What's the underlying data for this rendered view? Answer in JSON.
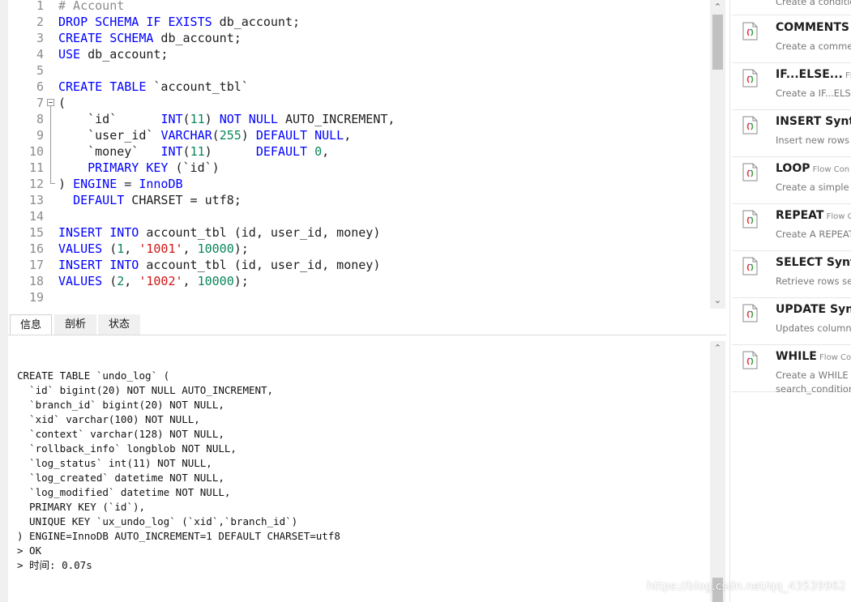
{
  "editor": {
    "lines": [
      {
        "n": "1",
        "segs": [
          {
            "t": "# Account",
            "c": "cmt"
          }
        ]
      },
      {
        "n": "2",
        "segs": [
          {
            "t": "DROP SCHEMA IF EXISTS",
            "c": "kw"
          },
          {
            "t": " db_account;",
            "c": "txt"
          }
        ]
      },
      {
        "n": "3",
        "segs": [
          {
            "t": "CREATE SCHEMA",
            "c": "kw"
          },
          {
            "t": " db_account;",
            "c": "txt"
          }
        ]
      },
      {
        "n": "4",
        "segs": [
          {
            "t": "USE",
            "c": "kw"
          },
          {
            "t": " db_account;",
            "c": "txt"
          }
        ]
      },
      {
        "n": "5",
        "segs": []
      },
      {
        "n": "6",
        "segs": [
          {
            "t": "CREATE TABLE",
            "c": "kw"
          },
          {
            "t": " `account_tbl`",
            "c": "txt"
          }
        ]
      },
      {
        "n": "7",
        "segs": [
          {
            "t": "(",
            "c": "txt"
          }
        ]
      },
      {
        "n": "8",
        "segs": [
          {
            "t": "    `id`      ",
            "c": "txt"
          },
          {
            "t": "INT",
            "c": "ty"
          },
          {
            "t": "(",
            "c": "txt"
          },
          {
            "t": "11",
            "c": "num"
          },
          {
            "t": ") ",
            "c": "txt"
          },
          {
            "t": "NOT NULL",
            "c": "kw"
          },
          {
            "t": " AUTO_INCREMENT,",
            "c": "txt"
          }
        ]
      },
      {
        "n": "9",
        "segs": [
          {
            "t": "    `user_id` ",
            "c": "txt"
          },
          {
            "t": "VARCHAR",
            "c": "ty"
          },
          {
            "t": "(",
            "c": "txt"
          },
          {
            "t": "255",
            "c": "num"
          },
          {
            "t": ") ",
            "c": "txt"
          },
          {
            "t": "DEFAULT NULL",
            "c": "kw"
          },
          {
            "t": ",",
            "c": "txt"
          }
        ]
      },
      {
        "n": "10",
        "segs": [
          {
            "t": "    `money`   ",
            "c": "txt"
          },
          {
            "t": "INT",
            "c": "ty"
          },
          {
            "t": "(",
            "c": "txt"
          },
          {
            "t": "11",
            "c": "num"
          },
          {
            "t": ")      ",
            "c": "txt"
          },
          {
            "t": "DEFAULT",
            "c": "kw"
          },
          {
            "t": " ",
            "c": "txt"
          },
          {
            "t": "0",
            "c": "num"
          },
          {
            "t": ",",
            "c": "txt"
          }
        ]
      },
      {
        "n": "11",
        "segs": [
          {
            "t": "    ",
            "c": "txt"
          },
          {
            "t": "PRIMARY KEY",
            "c": "kw"
          },
          {
            "t": " (`id`)",
            "c": "txt"
          }
        ]
      },
      {
        "n": "12",
        "segs": [
          {
            "t": ") ",
            "c": "txt"
          },
          {
            "t": "ENGINE",
            "c": "kw"
          },
          {
            "t": " = ",
            "c": "txt"
          },
          {
            "t": "InnoDB",
            "c": "kw"
          }
        ]
      },
      {
        "n": "13",
        "segs": [
          {
            "t": "  ",
            "c": "txt"
          },
          {
            "t": "DEFAULT",
            "c": "kw"
          },
          {
            "t": " CHARSET = utf8;",
            "c": "txt"
          }
        ]
      },
      {
        "n": "14",
        "segs": []
      },
      {
        "n": "15",
        "segs": [
          {
            "t": "INSERT INTO",
            "c": "kw"
          },
          {
            "t": " account_tbl (id, user_id, money)",
            "c": "txt"
          }
        ]
      },
      {
        "n": "16",
        "segs": [
          {
            "t": "VALUES",
            "c": "kw"
          },
          {
            "t": " (",
            "c": "txt"
          },
          {
            "t": "1",
            "c": "num"
          },
          {
            "t": ", ",
            "c": "txt"
          },
          {
            "t": "'1001'",
            "c": "str"
          },
          {
            "t": ", ",
            "c": "txt"
          },
          {
            "t": "10000",
            "c": "num"
          },
          {
            "t": ");",
            "c": "txt"
          }
        ]
      },
      {
        "n": "17",
        "segs": [
          {
            "t": "INSERT INTO",
            "c": "kw"
          },
          {
            "t": " account_tbl (id, user_id, money)",
            "c": "txt"
          }
        ]
      },
      {
        "n": "18",
        "segs": [
          {
            "t": "VALUES",
            "c": "kw"
          },
          {
            "t": " (",
            "c": "txt"
          },
          {
            "t": "2",
            "c": "num"
          },
          {
            "t": ", ",
            "c": "txt"
          },
          {
            "t": "'1002'",
            "c": "str"
          },
          {
            "t": ", ",
            "c": "txt"
          },
          {
            "t": "10000",
            "c": "num"
          },
          {
            "t": ");",
            "c": "txt"
          }
        ]
      },
      {
        "n": "19",
        "segs": []
      }
    ]
  },
  "tabs": [
    {
      "label": "信息",
      "active": true
    },
    {
      "label": "剖析",
      "active": false
    },
    {
      "label": "状态",
      "active": false
    }
  ],
  "output": {
    "lines": [
      "CREATE TABLE `undo_log` (",
      "  `id` bigint(20) NOT NULL AUTO_INCREMENT,",
      "  `branch_id` bigint(20) NOT NULL,",
      "  `xid` varchar(100) NOT NULL,",
      "  `context` varchar(128) NOT NULL,",
      "  `rollback_info` longblob NOT NULL,",
      "  `log_status` int(11) NOT NULL,",
      "  `log_created` datetime NOT NULL,",
      "  `log_modified` datetime NOT NULL,",
      "  PRIMARY KEY (`id`),",
      "  UNIQUE KEY `ux_undo_log` (`xid`,`branch_id`)",
      ") ENGINE=InnoDB AUTO_INCREMENT=1 DEFAULT CHARSET=utf8",
      "> OK",
      "> 时间: 0.07s"
    ]
  },
  "snippets": {
    "top_desc": "Create a conditio",
    "items": [
      {
        "title": "COMMENTS",
        "cat": "",
        "desc": "Create a comme",
        "desc2": ""
      },
      {
        "title": "IF...ELSE...",
        "cat": " Flow",
        "desc": "Create a IF...ELSE",
        "desc2": ""
      },
      {
        "title": "INSERT Synt",
        "cat": "",
        "desc": "Insert new rows",
        "desc2": ""
      },
      {
        "title": "LOOP",
        "cat": " Flow Con",
        "desc": "Create a simple",
        "desc2": ""
      },
      {
        "title": "REPEAT",
        "cat": " Flow C",
        "desc": "Create A REPEAT",
        "desc2": ""
      },
      {
        "title": "SELECT Synta",
        "cat": "",
        "desc": "Retrieve rows se",
        "desc2": ""
      },
      {
        "title": "UPDATE Synt",
        "cat": "",
        "desc": "Updates column",
        "desc2": ""
      },
      {
        "title": "WHILE",
        "cat": " Flow Co",
        "desc": "Create a WHILE",
        "desc2": "search_condition"
      }
    ],
    "icon_name": "code-snippet-icon",
    "icon_colors": {
      "left": "#e53935",
      "right": "#43a047",
      "accent": "#1e88e5"
    }
  },
  "watermark": "https://blog.csdn.net/qq_43539962"
}
